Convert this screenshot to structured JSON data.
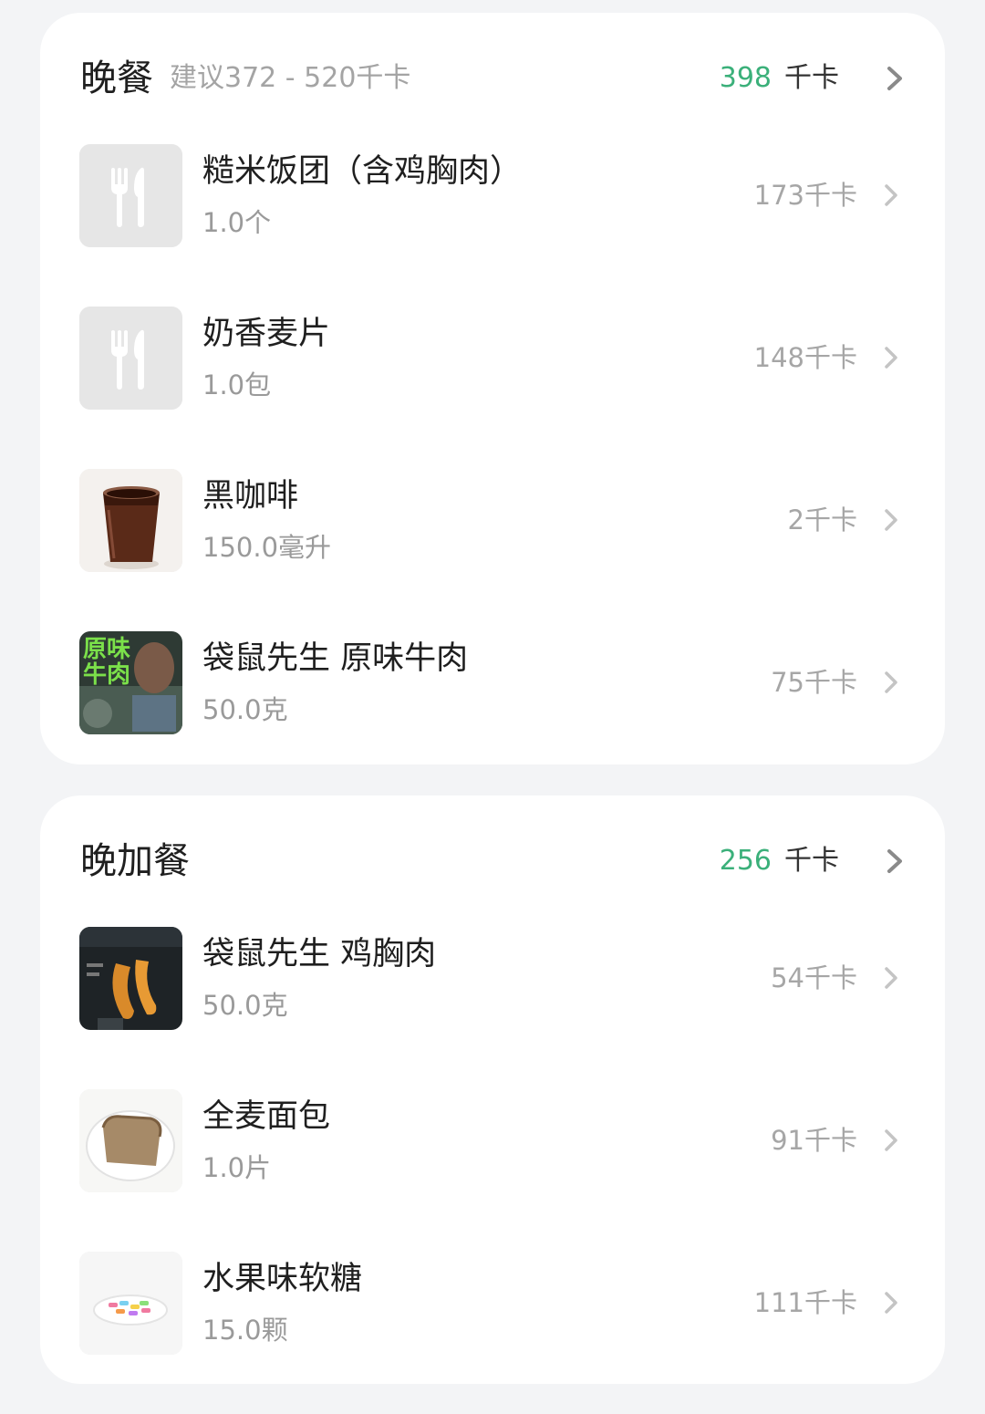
{
  "colors": {
    "accent_green": "#3bb07a",
    "card_bg": "#ffffff",
    "page_bg": "#f3f4f6"
  },
  "dinner": {
    "title": "晚餐",
    "suggestion": "建议372 - 520千卡",
    "total_value": "398",
    "total_unit": "千卡",
    "items": [
      {
        "name": "糙米饭团（含鸡胸肉）",
        "quantity": "1.0个",
        "calories": "173千卡",
        "icon": "fork-knife-placeholder-icon"
      },
      {
        "name": "奶香麦片",
        "quantity": "1.0包",
        "calories": "148千卡",
        "icon": "fork-knife-placeholder-icon"
      },
      {
        "name": "黑咖啡",
        "quantity": "150.0毫升",
        "calories": "2千卡",
        "icon": "black-coffee-photo"
      },
      {
        "name": "袋鼠先生 原味牛肉",
        "quantity": "50.0克",
        "calories": "75千卡",
        "icon": "beef-package-photo",
        "image_text": "原味牛肉"
      }
    ]
  },
  "snack": {
    "title": "晚加餐",
    "total_value": "256",
    "total_unit": "千卡",
    "items": [
      {
        "name": "袋鼠先生 鸡胸肉",
        "quantity": "50.0克",
        "calories": "54千卡",
        "icon": "chicken-breast-package-photo"
      },
      {
        "name": "全麦面包",
        "quantity": "1.0片",
        "calories": "91千卡",
        "icon": "whole-wheat-bread-photo"
      },
      {
        "name": "水果味软糖",
        "quantity": "15.0颗",
        "calories": "111千卡",
        "icon": "gummy-candy-photo"
      }
    ]
  }
}
